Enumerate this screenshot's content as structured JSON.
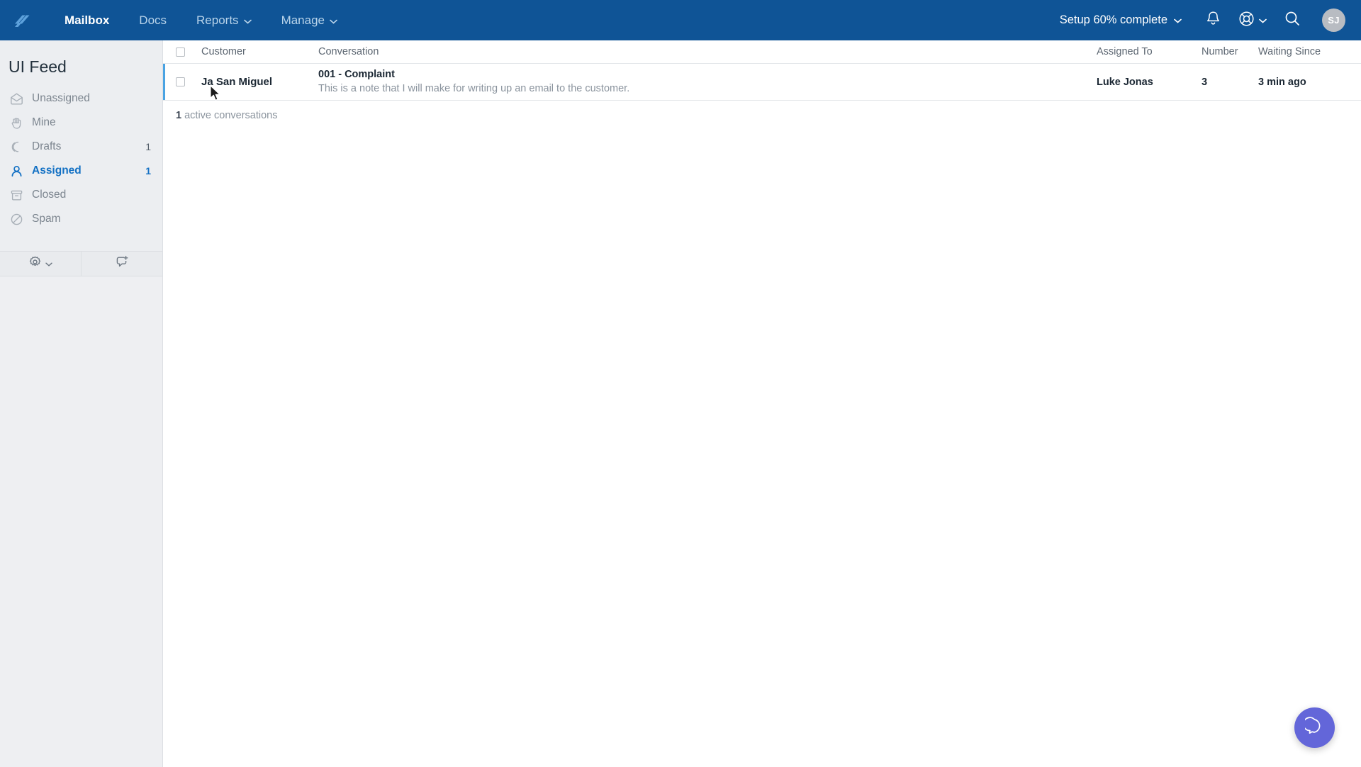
{
  "header": {
    "logo_name": "helpscout-logo",
    "nav": [
      {
        "label": "Mailbox",
        "active": true,
        "has_chevron": false
      },
      {
        "label": "Docs",
        "active": false,
        "has_chevron": false
      },
      {
        "label": "Reports",
        "active": false,
        "has_chevron": true
      },
      {
        "label": "Manage",
        "active": false,
        "has_chevron": true
      }
    ],
    "setup_label": "Setup 60% complete",
    "notifications_icon": "bell-icon",
    "help_icon": "lifebuoy-icon",
    "search_icon": "search-icon",
    "avatar_initials": "SJ",
    "background_color": "#0f5496"
  },
  "sidebar": {
    "title": "UI Feed",
    "items": [
      {
        "label": "Unassigned",
        "count": "",
        "icon": "envelope-open-icon",
        "active": false
      },
      {
        "label": "Mine",
        "count": "",
        "icon": "hand-icon",
        "active": false
      },
      {
        "label": "Drafts",
        "count": "1",
        "icon": "layers-icon",
        "active": false
      },
      {
        "label": "Assigned",
        "count": "1",
        "icon": "person-icon",
        "active": true
      },
      {
        "label": "Closed",
        "count": "",
        "icon": "archive-icon",
        "active": false
      },
      {
        "label": "Spam",
        "count": "",
        "icon": "ban-icon",
        "active": false
      }
    ],
    "toolbar": {
      "settings_icon": "gear-icon",
      "new_conversation_icon": "new-conversation-icon"
    },
    "active_color": "#1471c4",
    "background_color": "#eceef1"
  },
  "list": {
    "columns": {
      "customer": "Customer",
      "conversation": "Conversation",
      "assigned_to": "Assigned To",
      "number": "Number",
      "waiting_since": "Waiting Since"
    },
    "rows": [
      {
        "customer": "Ja San Miguel",
        "subject": "001 - Complaint",
        "preview": "This is a note that I will make for writing up an email to the customer.",
        "assigned_to": "Luke Jonas",
        "number": "3",
        "waiting_since": "3 min ago",
        "checked": false
      }
    ],
    "footer_count": "1",
    "footer_label": "active conversations",
    "row_accent_color": "#4aa3e3"
  },
  "beacon": {
    "icon": "chat-bubble-icon",
    "color": "#6366d9"
  }
}
